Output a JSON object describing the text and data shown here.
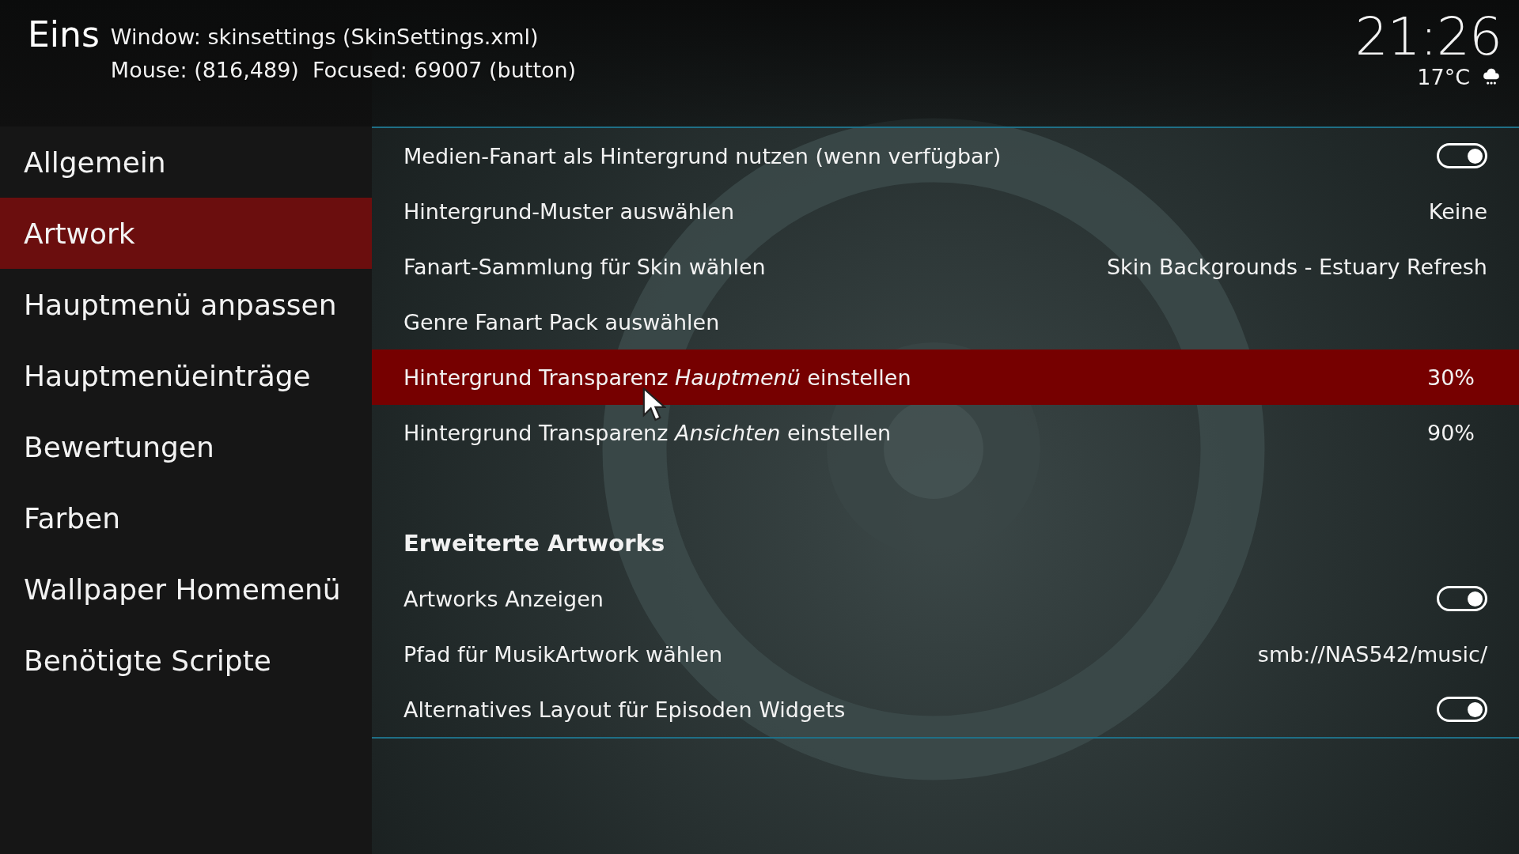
{
  "header": {
    "title": "Eins",
    "debug": [
      "Window: skinsettings (SkinSettings.xml)",
      "Mouse: (816,489)  Focused: 69007 (button)"
    ],
    "clock": "21:26",
    "temperature": "17°C"
  },
  "sidebar": {
    "items": [
      {
        "label": "Allgemein",
        "selected": false
      },
      {
        "label": "Artwork",
        "selected": true
      },
      {
        "label": "Hauptmenü anpassen",
        "selected": false
      },
      {
        "label": "Hauptmenüeinträge",
        "selected": false
      },
      {
        "label": "Bewertungen",
        "selected": false
      },
      {
        "label": "Farben",
        "selected": false
      },
      {
        "label": "Wallpaper Homemenü",
        "selected": false
      },
      {
        "label": "Benötigte Scripte",
        "selected": false
      }
    ]
  },
  "settings": [
    {
      "kind": "toggle",
      "label": "Medien-Fanart als Hintergrund nutzen (wenn verfügbar)",
      "on": true,
      "selected": false
    },
    {
      "kind": "value",
      "label": "Hintergrund-Muster auswählen",
      "value": "Keine",
      "selected": false
    },
    {
      "kind": "value",
      "label": "Fanart-Sammlung für Skin wählen",
      "value": "Skin Backgrounds - Estuary Refresh",
      "selected": false
    },
    {
      "kind": "plain",
      "label": "Genre Fanart Pack auswählen",
      "selected": false
    },
    {
      "kind": "percent",
      "label": "Hintergrund Transparenz *Hauptmenü* einstellen",
      "value": "30%",
      "selected": true
    },
    {
      "kind": "percent",
      "label": "Hintergrund Transparenz *Ansichten* einstellen",
      "value": "90%",
      "selected": false
    },
    {
      "kind": "header",
      "label": "Erweiterte Artworks"
    },
    {
      "kind": "toggle",
      "label": "Artworks Anzeigen",
      "on": true,
      "selected": false
    },
    {
      "kind": "value",
      "label": "Pfad für MusikArtwork wählen",
      "value": "smb://NAS542/music/",
      "selected": false
    },
    {
      "kind": "toggle",
      "label": "Alternatives Layout für Episoden Widgets",
      "on": true,
      "selected": false
    }
  ]
}
